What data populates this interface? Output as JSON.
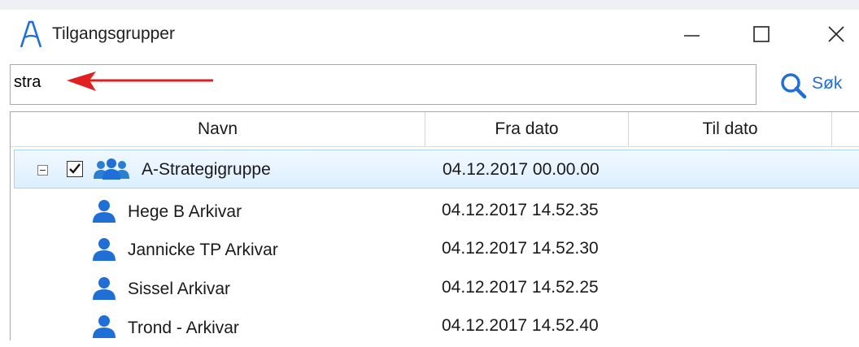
{
  "window": {
    "title": "Tilgangsgrupper",
    "controls": [
      "minimize-icon",
      "maximize-icon",
      "close-icon"
    ]
  },
  "search": {
    "value": "stra",
    "button_label": "Søk",
    "button_icon": "search-icon"
  },
  "grid": {
    "columns": [
      "Navn",
      "Fra dato",
      "Til dato"
    ],
    "rows": [
      {
        "name": "A-Strategigruppe",
        "from": "04.12.2017 00.00.00",
        "to": "",
        "type": "group",
        "checked": true,
        "expanded": true,
        "selected": true
      },
      {
        "name": "Hege B Arkivar",
        "from": "04.12.2017 14.52.35",
        "to": "",
        "type": "user"
      },
      {
        "name": "Jannicke TP Arkivar",
        "from": "04.12.2017 14.52.30",
        "to": "",
        "type": "user"
      },
      {
        "name": "Sissel Arkivar",
        "from": "04.12.2017 14.52.25",
        "to": "",
        "type": "user"
      },
      {
        "name": "Trond - Arkivar",
        "from": "04.12.2017 14.52.40",
        "to": "",
        "type": "user"
      }
    ]
  },
  "colors": {
    "accent": "#1f6fd6",
    "annotation_arrow": "#e02020",
    "selection": "#dcefff"
  }
}
